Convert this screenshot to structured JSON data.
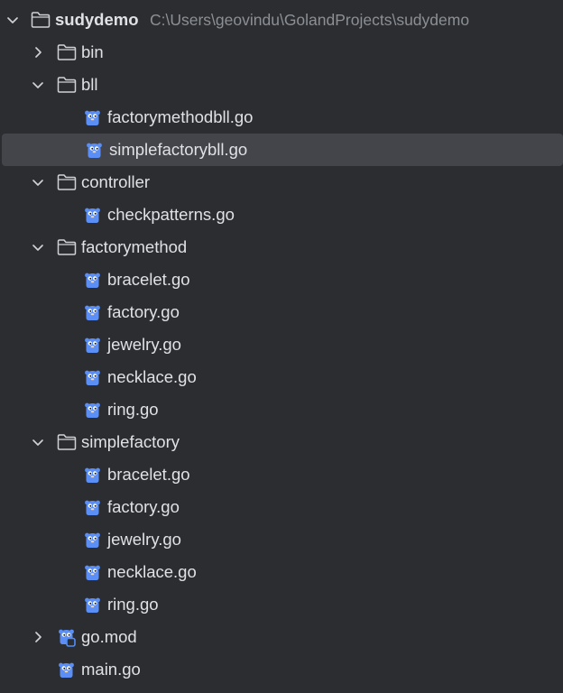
{
  "project": {
    "name": "sudydemo",
    "path": "C:\\Users\\geovindu\\GolandProjects\\sudydemo",
    "expanded": true
  },
  "tree": [
    {
      "label": "bin",
      "kind": "folder",
      "depth": 1,
      "expanded": false
    },
    {
      "label": "bll",
      "kind": "folder",
      "depth": 1,
      "expanded": true
    },
    {
      "label": "factorymethodbll.go",
      "kind": "go-file",
      "depth": 2
    },
    {
      "label": "simplefactorybll.go",
      "kind": "go-file",
      "depth": 2,
      "selected": true
    },
    {
      "label": "controller",
      "kind": "folder",
      "depth": 1,
      "expanded": true
    },
    {
      "label": "checkpatterns.go",
      "kind": "go-file",
      "depth": 2
    },
    {
      "label": "factorymethod",
      "kind": "folder",
      "depth": 1,
      "expanded": true
    },
    {
      "label": "bracelet.go",
      "kind": "go-file",
      "depth": 2
    },
    {
      "label": "factory.go",
      "kind": "go-file",
      "depth": 2
    },
    {
      "label": "jewelry.go",
      "kind": "go-file",
      "depth": 2
    },
    {
      "label": "necklace.go",
      "kind": "go-file",
      "depth": 2
    },
    {
      "label": "ring.go",
      "kind": "go-file",
      "depth": 2
    },
    {
      "label": "simplefactory",
      "kind": "folder",
      "depth": 1,
      "expanded": true
    },
    {
      "label": "bracelet.go",
      "kind": "go-file",
      "depth": 2
    },
    {
      "label": "factory.go",
      "kind": "go-file",
      "depth": 2
    },
    {
      "label": "jewelry.go",
      "kind": "go-file",
      "depth": 2
    },
    {
      "label": "necklace.go",
      "kind": "go-file",
      "depth": 2
    },
    {
      "label": "ring.go",
      "kind": "go-file",
      "depth": 2
    },
    {
      "label": "go.mod",
      "kind": "go-mod",
      "depth": 1,
      "expanded": false
    },
    {
      "label": "main.go",
      "kind": "go-file",
      "depth": 1
    }
  ],
  "colors": {
    "background": "#2b2d30",
    "selection": "#43454a",
    "text": "#dfe1e5",
    "path_text": "#8c8f94",
    "gopher": "#5b8ff5"
  }
}
